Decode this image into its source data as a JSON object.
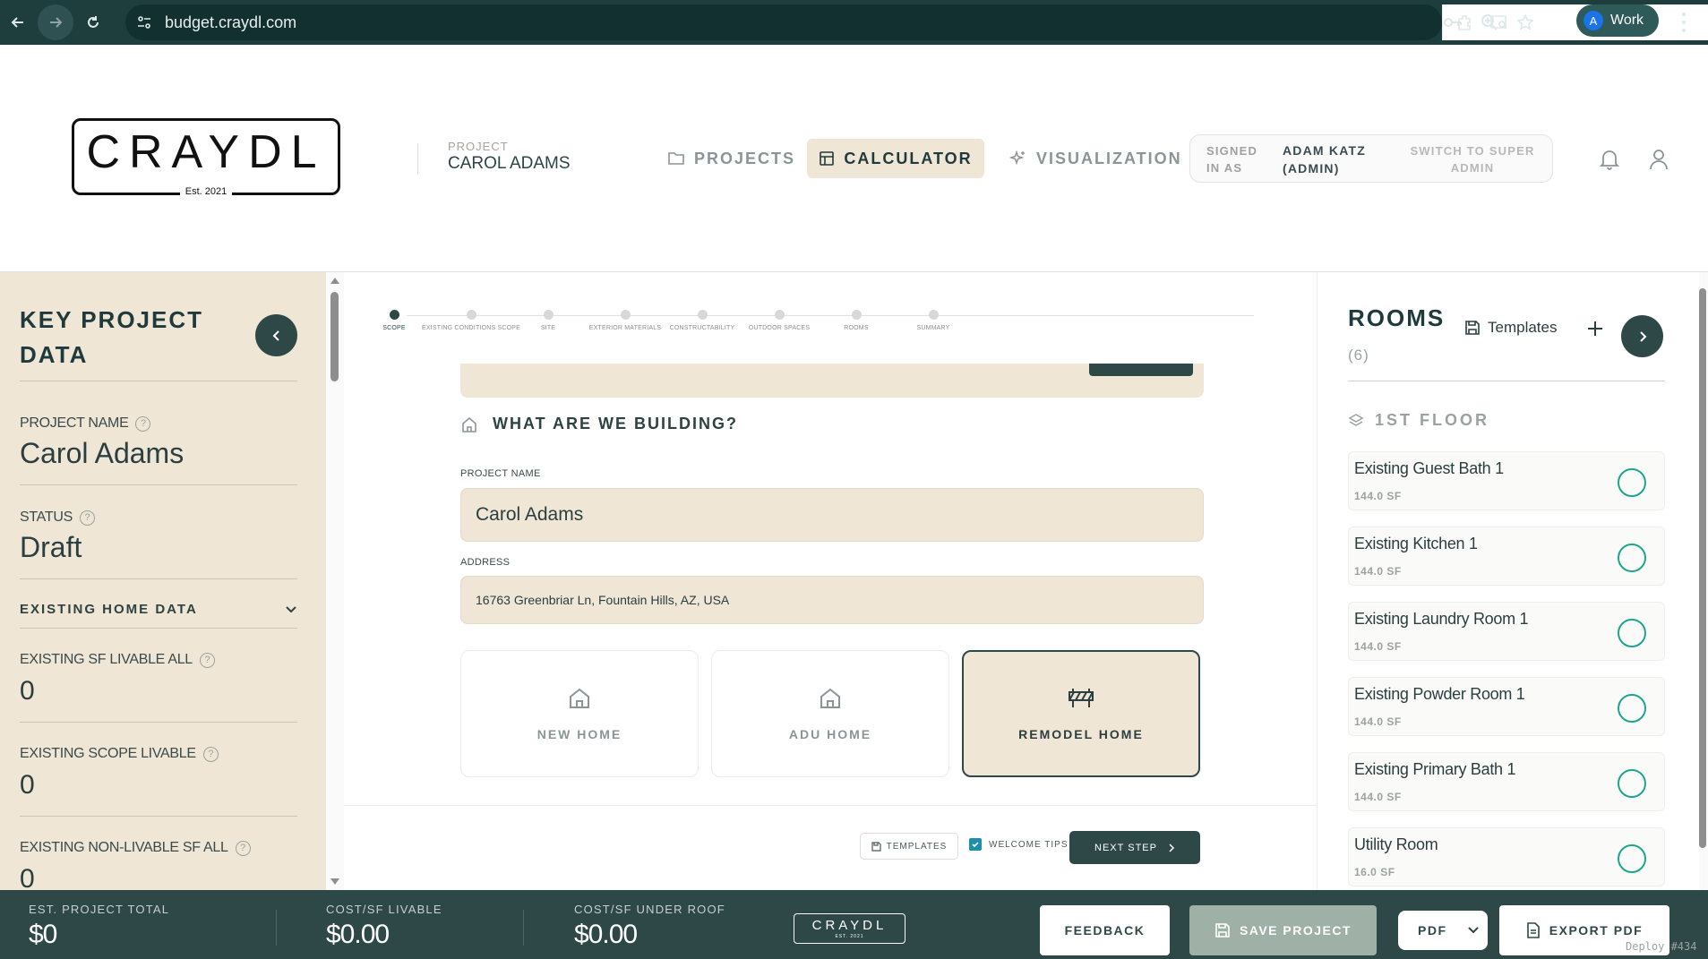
{
  "browser": {
    "url": "budget.craydl.com",
    "profile_initial": "A",
    "profile_name": "Work"
  },
  "header": {
    "logo_text": "CRAYDL",
    "logo_est": "Est. 2021",
    "project_label": "PROJECT",
    "project_name": "CAROL ADAMS",
    "nav": {
      "projects": "PROJECTS",
      "calculator": "CALCULATOR",
      "visualization": "VISUALIZATION"
    },
    "signed_in_label": "SIGNED IN AS",
    "signed_in_user": "ADAM KATZ (ADMIN)",
    "switch_label": "SWITCH TO SUPER ADMIN"
  },
  "left_panel": {
    "title": "KEY PROJECT DATA",
    "fields": [
      {
        "label": "PROJECT NAME",
        "value": "Carol Adams"
      },
      {
        "label": "STATUS",
        "value": "Draft"
      }
    ],
    "section_title": "EXISTING HOME DATA",
    "home_fields": [
      {
        "label": "EXISTING SF LIVABLE ALL",
        "value": "0"
      },
      {
        "label": "EXISTING SCOPE LIVABLE",
        "value": "0"
      },
      {
        "label": "EXISTING NON-LIVABLE SF ALL",
        "value": "0"
      }
    ]
  },
  "stepper": {
    "steps": [
      "SCOPE",
      "EXISTING CONDITIONS SCOPE",
      "SITE",
      "EXTERIOR MATERIALS",
      "CONSTRUCTABILITY",
      "OUTDOOR SPACES",
      "ROOMS",
      "SUMMARY"
    ],
    "active_index": 0
  },
  "main": {
    "section_title": "WHAT ARE WE BUILDING?",
    "project_name_label": "PROJECT NAME",
    "project_name_value": "Carol Adams",
    "address_label": "ADDRESS",
    "address_value": "16763 Greenbriar Ln, Fountain Hills, AZ, USA",
    "options": [
      {
        "label": "NEW HOME",
        "icon": "house-icon",
        "selected": false
      },
      {
        "label": "ADU HOME",
        "icon": "house-icon",
        "selected": false
      },
      {
        "label": "REMODEL HOME",
        "icon": "barrier-icon",
        "selected": true
      }
    ],
    "templates_label": "TEMPLATES",
    "welcome_tips_label": "WELCOME TIPS",
    "welcome_tips_checked": true,
    "next_step_label": "NEXT STEP"
  },
  "rooms_panel": {
    "title": "ROOMS",
    "count": "(6)",
    "templates_label": "Templates",
    "floor_label": "1ST FLOOR",
    "rooms": [
      {
        "name": "Existing Guest Bath 1",
        "size": "144.0 SF"
      },
      {
        "name": "Existing Kitchen 1",
        "size": "144.0 SF"
      },
      {
        "name": "Existing Laundry Room 1",
        "size": "144.0 SF"
      },
      {
        "name": "Existing Powder Room 1",
        "size": "144.0 SF"
      },
      {
        "name": "Existing Primary Bath 1",
        "size": "144.0 SF"
      },
      {
        "name": "Utility Room",
        "size": "16.0 SF"
      }
    ]
  },
  "bottom_bar": {
    "est_total_label": "EST. PROJECT TOTAL",
    "est_total_value": "$0",
    "cost_livable_label": "COST/SF LIVABLE",
    "cost_livable_value": "$0.00",
    "cost_roof_label": "COST/SF UNDER ROOF",
    "cost_roof_value": "$0.00",
    "logo_text": "CRAYDL",
    "logo_sub": "EST. 2021",
    "feedback_label": "FEEDBACK",
    "save_label": "SAVE PROJECT",
    "format_value": "PDF",
    "export_label": "EXPORT PDF",
    "deploy_tag": "Deploy #434"
  },
  "colors": {
    "dark_teal": "#2e4848",
    "beige": "#efe6d5",
    "accent_green": "#1fa58d"
  }
}
